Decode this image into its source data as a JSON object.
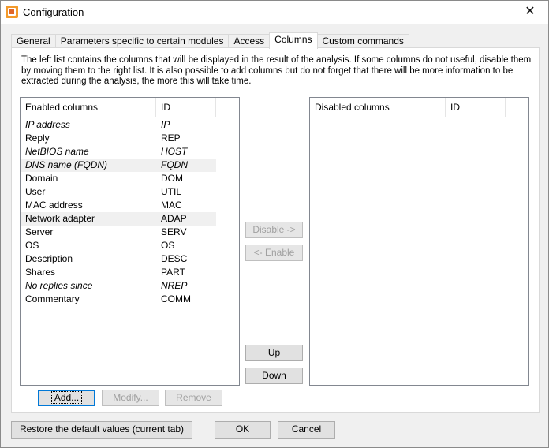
{
  "window": {
    "title": "Configuration",
    "close_glyph": "✕"
  },
  "tabs": [
    {
      "label": "General",
      "active": false
    },
    {
      "label": "Parameters specific to certain modules",
      "active": false
    },
    {
      "label": "Access",
      "active": false
    },
    {
      "label": "Columns",
      "active": true
    },
    {
      "label": "Custom commands",
      "active": false
    }
  ],
  "description": "The left list contains the columns that will be displayed in the result of the analysis. If some columns do not useful, disable them by moving them to the right list. It is also possible to add columns but do not forget that there will be more information to be extracted during the analysis, the more this will take time.",
  "enabled_list": {
    "header_name": "Enabled columns",
    "header_id": "ID",
    "rows": [
      {
        "name": "IP address",
        "id": "IP",
        "italic": true,
        "alt": false
      },
      {
        "name": "Reply",
        "id": "REP",
        "italic": false,
        "alt": false
      },
      {
        "name": "NetBIOS name",
        "id": "HOST",
        "italic": true,
        "alt": false
      },
      {
        "name": "DNS name (FQDN)",
        "id": "FQDN",
        "italic": true,
        "alt": true
      },
      {
        "name": "Domain",
        "id": "DOM",
        "italic": false,
        "alt": false
      },
      {
        "name": "User",
        "id": "UTIL",
        "italic": false,
        "alt": false
      },
      {
        "name": "MAC address",
        "id": "MAC",
        "italic": false,
        "alt": false
      },
      {
        "name": "Network adapter",
        "id": "ADAP",
        "italic": false,
        "alt": true
      },
      {
        "name": "Server",
        "id": "SERV",
        "italic": false,
        "alt": false
      },
      {
        "name": "OS",
        "id": "OS",
        "italic": false,
        "alt": false
      },
      {
        "name": "Description",
        "id": "DESC",
        "italic": false,
        "alt": false
      },
      {
        "name": "Shares",
        "id": "PART",
        "italic": false,
        "alt": false
      },
      {
        "name": "No replies since",
        "id": "NREP",
        "italic": true,
        "alt": false
      },
      {
        "name": "Commentary",
        "id": "COMM",
        "italic": false,
        "alt": false
      }
    ]
  },
  "disabled_list": {
    "header_name": "Disabled columns",
    "header_id": "ID"
  },
  "move_buttons": {
    "disable": "Disable ->",
    "enable": "<- Enable",
    "up": "Up",
    "down": "Down"
  },
  "list_buttons": {
    "add": "Add...",
    "modify": "Modify...",
    "remove": "Remove"
  },
  "footer": {
    "restore": "Restore the default values (current tab)",
    "ok": "OK",
    "cancel": "Cancel"
  }
}
